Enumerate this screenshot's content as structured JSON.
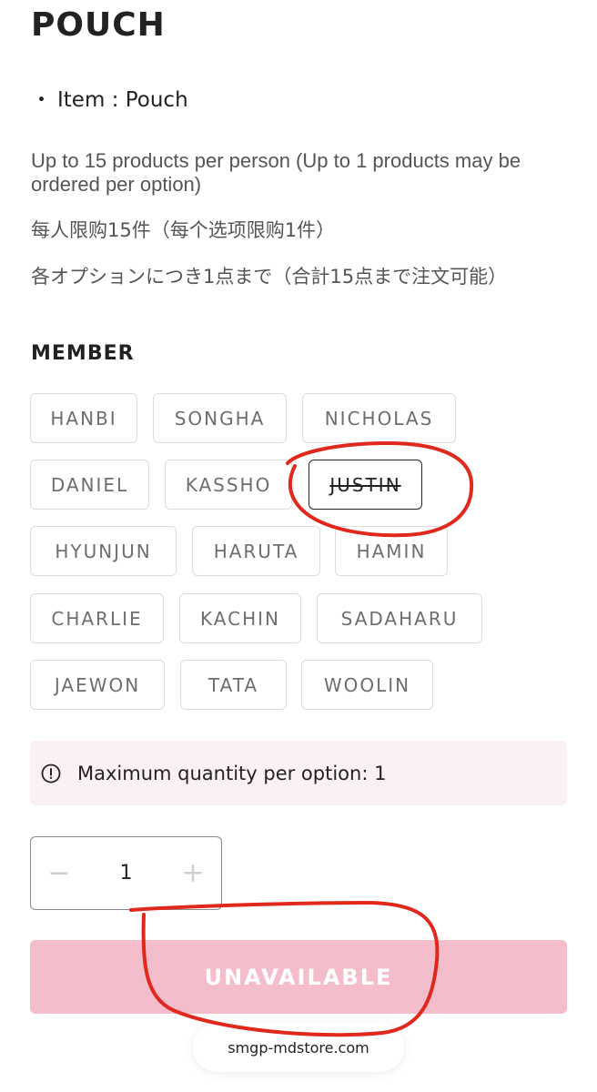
{
  "product": {
    "title": "POUCH",
    "item_bullet": "・",
    "item_line": "Item : Pouch"
  },
  "limits": {
    "en": "Up to 15 products per person (Up to 1 products may be ordered per option)",
    "zh": "每人限购15件（每个选项限购1件）",
    "ja": "各オプションにつき1点まで（合計15点まで注文可能）"
  },
  "member": {
    "heading": "MEMBER",
    "options": [
      {
        "label": "HANBI",
        "sold_out": false,
        "selected": false
      },
      {
        "label": "SONGHA",
        "sold_out": false,
        "selected": false
      },
      {
        "label": "NICHOLAS",
        "sold_out": false,
        "selected": false
      },
      {
        "label": "DANIEL",
        "sold_out": false,
        "selected": false
      },
      {
        "label": "KASSHO",
        "sold_out": false,
        "selected": false
      },
      {
        "label": "JUSTIN",
        "sold_out": true,
        "selected": true
      },
      {
        "label": "HYUNJUN",
        "sold_out": false,
        "selected": false
      },
      {
        "label": "HARUTA",
        "sold_out": false,
        "selected": false
      },
      {
        "label": "HAMIN",
        "sold_out": false,
        "selected": false
      },
      {
        "label": "CHARLIE",
        "sold_out": false,
        "selected": false
      },
      {
        "label": "KACHIN",
        "sold_out": false,
        "selected": false
      },
      {
        "label": "SADAHARU",
        "sold_out": false,
        "selected": false
      },
      {
        "label": "JAEWON",
        "sold_out": false,
        "selected": false
      },
      {
        "label": "TATA",
        "sold_out": false,
        "selected": false
      },
      {
        "label": "WOOLIN",
        "sold_out": false,
        "selected": false
      }
    ]
  },
  "notice": {
    "icon": "info-circle-icon",
    "text": "Maximum quantity per option: 1"
  },
  "quantity": {
    "minus": "−",
    "value": "1",
    "plus": "+"
  },
  "cta": {
    "label": "UNAVAILABLE"
  },
  "browser": {
    "url": "smgp-mdstore.com"
  },
  "colors": {
    "accent_pink": "#f4bdcc",
    "notice_bg": "#fbf1f2",
    "annotation_red": "#e0281c",
    "option_border": "#dddddd",
    "option_text": "#6e6e6e"
  }
}
